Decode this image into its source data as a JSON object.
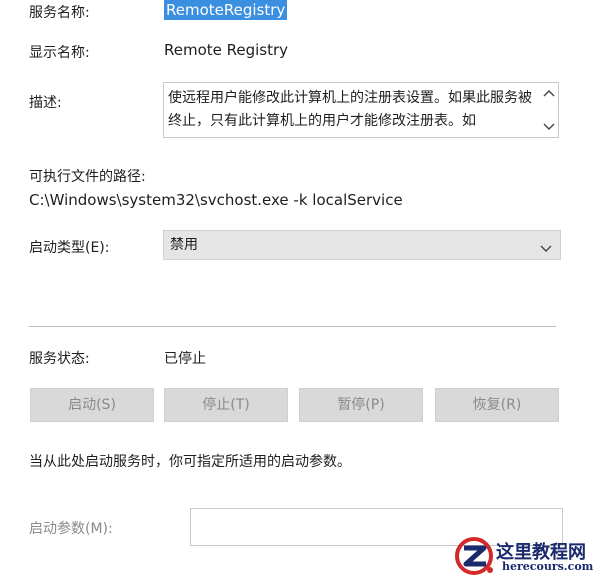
{
  "service": {
    "name_label": "服务名称:",
    "name_value": "RemoteRegistry",
    "display_label": "显示名称:",
    "display_value": "Remote Registry",
    "desc_label": "描述:",
    "desc_value": "使远程用户能修改此计算机上的注册表设置。如果此服务被终止，只有此计算机上的用户才能修改注册表。如",
    "path_label": "可执行文件的路径:",
    "path_value": "C:\\Windows\\system32\\svchost.exe -k localService",
    "startup_label": "启动类型(E):",
    "startup_value": "禁用",
    "status_label": "服务状态:",
    "status_value": "已停止"
  },
  "buttons": {
    "start": "启动(S)",
    "stop": "停止(T)",
    "pause": "暂停(P)",
    "resume": "恢复(R)"
  },
  "hint": "当从此处启动服务时，你可指定所适用的启动参数。",
  "params": {
    "label": "启动参数(M):",
    "value": ""
  },
  "watermark": {
    "title": "这里教程网",
    "subtitle": "herecours.com"
  },
  "colors": {
    "selection": "#3b8fe0",
    "disabled_button": "#d9d9d9",
    "disabled_text": "#8a8a8a",
    "watermark_red": "#d12a2a",
    "watermark_blue": "#1a2a6c"
  }
}
